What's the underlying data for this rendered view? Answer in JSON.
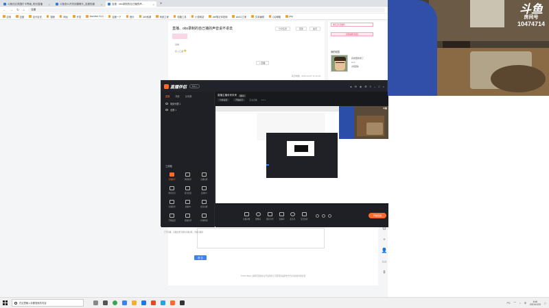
{
  "browser": {
    "tabs": [
      {
        "label": "斗鱼社区氛围打卡界面_阳光直播",
        "active": false
      },
      {
        "label": "斗鱼怎么开关闭摄像头_百度知道",
        "active": false
      },
      {
        "label": "百度 · obs录制的自己播的声...",
        "active": true
      }
    ],
    "url": "百度",
    "bookmarks": [
      "应用",
      "百度",
      "百分百安",
      "视频",
      "网址",
      "开发",
      "Manifest V3.0",
      "百度一下",
      "音乐",
      "360资源",
      "系统之家",
      "电脑工具",
      "小说网站",
      "dell笔记本官网",
      "win10之家",
      "文本编辑",
      "QQ邮箱",
      "php"
    ]
  },
  "question": {
    "title": "直播、obs录制的自己播的声音说不进去",
    "buttons": [
      "分享任务",
      "回答",
      "提问"
    ],
    "badge_label": "采纳",
    "user_label": "初入江湖",
    "answer_label": "+ 回答",
    "meta": "来自电脑 · 2021-03-07 11:12:04"
  },
  "sidebar_card": {
    "btn1": "做任务领福利",
    "btn2": "领取福利奖励",
    "section_title": "我的回答",
    "lines": [
      "完成更新成了",
      "Lv 1",
      "(去回答)"
    ]
  },
  "answer_box": {
    "submit_label": "提 交"
  },
  "footer": "©2021 Baidu  使用百度前必读  知道协议  百度知道品牌合作  知识商城问题反馈",
  "float_tools": [
    "settings-icon",
    "plus-icon",
    "person-icon",
    "feedback-icon",
    "top-icon"
  ],
  "obs": {
    "app_name": "直播伴侣",
    "version": "5.0.x",
    "scene_tabs": [
      "直播",
      "场景",
      "互动源"
    ],
    "scenes": [
      "场景列表 1",
      "全屏 1"
    ],
    "tools_title": "工具箱",
    "tools": [
      "直播助手",
      "弹幕助手",
      "点播功能",
      "粉丝红包",
      "道具连麦",
      "连线PK",
      "主播任务",
      "直播PK",
      "更多功能",
      "开播设置",
      "直播房间",
      "礼物答谢"
    ],
    "stream_info": "已开直播，点播连线开通的主播功能，查看直播间",
    "title": "直播主播未来未来",
    "tag": "新人",
    "sub_items": [
      "分类设置",
      "开播提示",
      "正在直播",
      "1.1.1"
    ],
    "bottom_buttons": [
      "直播录像",
      "摄像头",
      "图片背景",
      "直播间",
      "麦克风",
      "混合监听"
    ],
    "go_live": "开始直播"
  },
  "overlay": {
    "platform": "斗鱼",
    "room_label": "房间号",
    "room_number": "10474714"
  },
  "taskbar": {
    "search_placeholder": "在这里输入你要搜索的内容",
    "clock_time": "8:46",
    "clock_date": "2021/12/23",
    "lang": "中",
    "temp": "7°C"
  }
}
